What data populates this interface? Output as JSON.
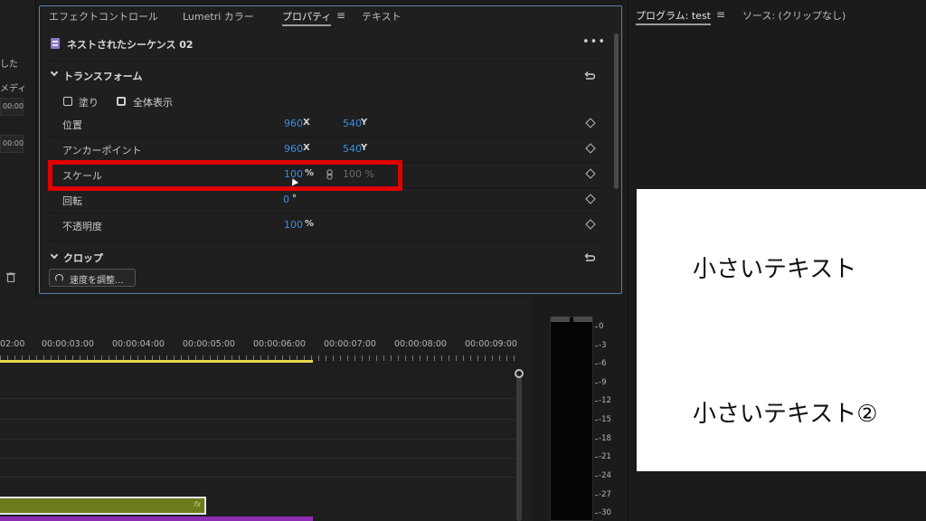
{
  "left_strip": {
    "fragments": [
      "した",
      "メディ"
    ],
    "timecodes": [
      "00:00",
      "00:00"
    ]
  },
  "effect_controls": {
    "tabs": [
      {
        "label": "エフェクトコントロール",
        "active": false
      },
      {
        "label": "Lumetri カラー",
        "active": false
      },
      {
        "label": "プロパティ",
        "active": true
      },
      {
        "label": "テキスト",
        "active": false
      }
    ],
    "menu_glyph": "≡",
    "sequence_title": "ネストされたシーケンス 02",
    "more_glyph": "•••",
    "transform_section": "トランスフォーム",
    "mask_options": [
      "塗り",
      "全体表示"
    ],
    "properties": [
      {
        "label": "位置",
        "value1": "960",
        "unit1": "X",
        "value2": "540",
        "unit2": "Y"
      },
      {
        "label": "アンカーポイント",
        "value1": "960",
        "unit1": "X",
        "value2": "540",
        "unit2": "Y"
      },
      {
        "label": "スケール",
        "value1": "100",
        "unit1": "%",
        "linked_value": "100 %"
      },
      {
        "label": "回転",
        "value1": "0",
        "unit1": "°"
      },
      {
        "label": "不透明度",
        "value1": "100",
        "unit1": "%"
      }
    ],
    "crop_section": "クロップ",
    "speed_button": "速度を調整..."
  },
  "timeline": {
    "timecodes": [
      "02:00",
      "00:00:03:00",
      "00:00:04:00",
      "00:00:05:00",
      "00:00:06:00",
      "00:00:07:00",
      "00:00:08:00",
      "00:00:09:00"
    ],
    "clip_fx": "fx"
  },
  "audio_meter": {
    "db_labels": [
      "0",
      "-3",
      "-6",
      "-9",
      "-12",
      "-15",
      "-18",
      "-21",
      "-24",
      "-27",
      "-30"
    ]
  },
  "program_monitor": {
    "program_tab": "プログラム: test",
    "menu_glyph": "≡",
    "source_tab": "ソース: (クリップなし)",
    "text_line_1": "小さいテキスト",
    "text_line_2": "小さいテキスト②"
  },
  "colors": {
    "value_blue": "#3d8de0",
    "highlight_red": "#e00000",
    "panel_border": "#5d7ea6",
    "work_area_yellow": "#e7d94a",
    "clip_olive": "#6c7c1d",
    "clip_purple": "#8e2bb3"
  }
}
